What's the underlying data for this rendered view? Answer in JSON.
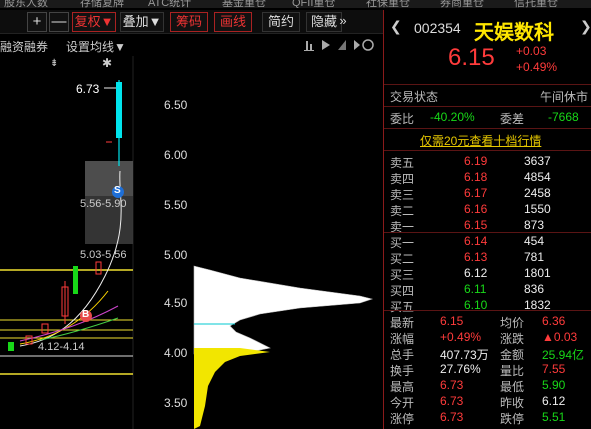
{
  "tabs": [
    "股东人数",
    "存储复牌",
    "ATC统计",
    "基金重仓",
    "QFII重仓",
    "社保重仓",
    "券商重仓",
    "信托重仓"
  ],
  "toolbar": {
    "plus": "+",
    "minus": "—",
    "fuquan": "复权▼",
    "diejia": "叠加▼",
    "chouma": "筹码",
    "huaxian": "画线",
    "jiandang": "简约",
    "yincang": "隐藏",
    "expand": "»"
  },
  "subbar": {
    "rongzi": "融资融券",
    "junxian": "设置均线▼",
    "marker_down": "⇟",
    "marker_star": "✱"
  },
  "chart": {
    "axis": [
      "6.50",
      "6.00",
      "5.50",
      "5.00",
      "4.50",
      "4.00",
      "3.50"
    ],
    "price_high": "6.73",
    "box_upper_label": "5.56-5.90",
    "box_mid_label": "5.03-5.56",
    "box_lower_label": "4.12-4.14",
    "marker_s": "S",
    "marker_b": "B"
  },
  "quote": {
    "code": "002354",
    "name": "天娱数科",
    "price": "6.15",
    "change": "+0.03",
    "change_pct": "+0.49%",
    "status_label": "交易状态",
    "status_value": "午间休市",
    "weibi_label": "委比",
    "weibi_value": "-40.20%",
    "weicha_label": "委差",
    "weicha_value": "-7668",
    "promo": "仅需20元查看十档行情",
    "sell": [
      {
        "label": "卖五",
        "price": "6.19",
        "vol": "3637"
      },
      {
        "label": "卖四",
        "price": "6.18",
        "vol": "4854"
      },
      {
        "label": "卖三",
        "price": "6.17",
        "vol": "2458"
      },
      {
        "label": "卖二",
        "price": "6.16",
        "vol": "1550"
      },
      {
        "label": "卖一",
        "price": "6.15",
        "vol": "873"
      }
    ],
    "buy": [
      {
        "label": "买一",
        "price": "6.14",
        "vol": "454"
      },
      {
        "label": "买二",
        "price": "6.13",
        "vol": "781"
      },
      {
        "label": "买三",
        "price": "6.12",
        "vol": "1801"
      },
      {
        "label": "买四",
        "price": "6.11",
        "vol": "836"
      },
      {
        "label": "买五",
        "price": "6.10",
        "vol": "1832"
      }
    ],
    "stats": [
      {
        "l1": "最新",
        "v1": "6.15",
        "c1": "red",
        "l2": "均价",
        "v2": "6.36",
        "c2": "red"
      },
      {
        "l1": "涨幅",
        "v1": "+0.49%",
        "c1": "red",
        "l2": "涨跌",
        "v2": "▲0.03",
        "c2": "red"
      },
      {
        "l1": "总手",
        "v1": "407.73万",
        "c1": "white",
        "l2": "金额",
        "v2": "25.94亿",
        "c2": "green"
      },
      {
        "l1": "换手",
        "v1": "27.76%",
        "c1": "white",
        "l2": "量比",
        "v2": "7.55",
        "c2": "red"
      },
      {
        "l1": "最高",
        "v1": "6.73",
        "c1": "red",
        "l2": "最低",
        "v2": "5.90",
        "c2": "green"
      },
      {
        "l1": "今开",
        "v1": "6.73",
        "c1": "red",
        "l2": "昨收",
        "v2": "6.12",
        "c2": "white"
      },
      {
        "l1": "涨停",
        "v1": "6.73",
        "c1": "red",
        "l2": "跌停",
        "v2": "5.51",
        "c2": "green"
      }
    ]
  },
  "colors": {
    "up": "#ff3b3b",
    "down": "#18d818",
    "accent": "#e6c700",
    "link": "#e6c700"
  }
}
